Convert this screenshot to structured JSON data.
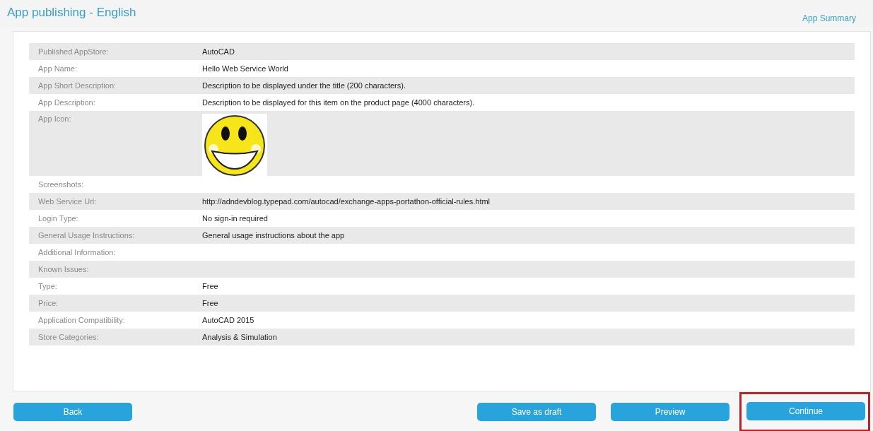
{
  "header": {
    "title": "App publishing - English",
    "summary_link": "App Summary"
  },
  "details": [
    {
      "kind": "text",
      "label": "Published AppStore:",
      "value": "AutoCAD"
    },
    {
      "kind": "text",
      "label": "App Name:",
      "value": "Hello Web Service World"
    },
    {
      "kind": "text",
      "label": "App Short Description:",
      "value": "Description to be displayed under the title (200 characters)."
    },
    {
      "kind": "text",
      "label": "App Description:",
      "value": "Description to be displayed for this item on the product page (4000 characters)."
    },
    {
      "kind": "image",
      "label": "App Icon:"
    },
    {
      "kind": "text",
      "label": "Screenshots:"
    },
    {
      "kind": "text",
      "label": "Web Service Url:",
      "value": "http://adndevblog.typepad.com/autocad/exchange-apps-portathon-official-rules.html"
    },
    {
      "kind": "text",
      "label": "Login Type:",
      "value": "No sign-in required"
    },
    {
      "kind": "text",
      "label": "General Usage Instructions:",
      "value": "General usage instructions about the app"
    },
    {
      "kind": "text",
      "label": "Additional Information:"
    },
    {
      "kind": "text",
      "label": "Known Issues:"
    },
    {
      "kind": "text",
      "label": "Type:",
      "value": "Free"
    },
    {
      "kind": "text",
      "label": "Price:",
      "value": "Free"
    },
    {
      "kind": "text",
      "label": "Application Compatibility:",
      "value": "AutoCAD 2015"
    },
    {
      "kind": "text",
      "label": "Store Categories:",
      "value": "Analysis & Simulation"
    }
  ],
  "buttons": [
    {
      "label": "Back",
      "highlighted": false
    },
    {
      "label": "Save as draft",
      "highlighted": false
    },
    {
      "label": "Preview",
      "highlighted": false
    },
    {
      "label": "Continue",
      "highlighted": true
    }
  ]
}
